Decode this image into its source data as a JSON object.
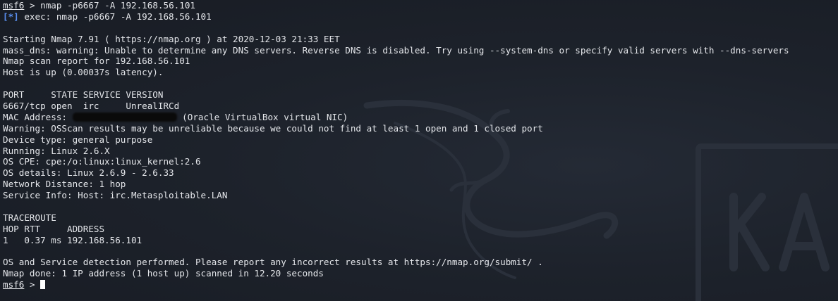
{
  "prompt": {
    "name": "msf6",
    "symbol": ">"
  },
  "command": "nmap -p6667 -A 192.168.56.101",
  "exec": {
    "tag": "[*]",
    "text": "exec: nmap -p6667 -A 192.168.56.101"
  },
  "output": {
    "starting": "Starting Nmap 7.91 ( https://nmap.org ) at 2020-12-03 21:33 EET",
    "mass_dns": "mass_dns: warning: Unable to determine any DNS servers. Reverse DNS is disabled. Try using --system-dns or specify valid servers with --dns-servers",
    "scan_report": "Nmap scan report for 192.168.56.101",
    "host_up": "Host is up (0.00037s latency).",
    "port_header": "PORT     STATE SERVICE VERSION",
    "port_row": "6667/tcp open  irc     UnrealIRCd",
    "mac_label": "MAC Address: ",
    "mac_vendor": " (Oracle VirtualBox virtual NIC)",
    "warning": "Warning: OSScan results may be unreliable because we could not find at least 1 open and 1 closed port",
    "device_type": "Device type: general purpose",
    "running": "Running: Linux 2.6.X",
    "os_cpe": "OS CPE: cpe:/o:linux:linux_kernel:2.6",
    "os_details": "OS details: Linux 2.6.9 - 2.6.33",
    "network_distance": "Network Distance: 1 hop",
    "service_info": "Service Info: Host: irc.Metasploitable.LAN",
    "traceroute": "TRACEROUTE",
    "trace_header": "HOP RTT     ADDRESS",
    "trace_row": "1   0.37 ms 192.168.56.101",
    "os_detection": "OS and Service detection performed. Please report any incorrect results at https://nmap.org/submit/ .",
    "done": "Nmap done: 1 IP address (1 host up) scanned in 12.20 seconds"
  },
  "colors": {
    "background": "#1c2029",
    "text": "#e4e6ea",
    "tag": "#5a8ff0"
  },
  "icons": {
    "wallpaper": "kali-dragon-icon"
  }
}
